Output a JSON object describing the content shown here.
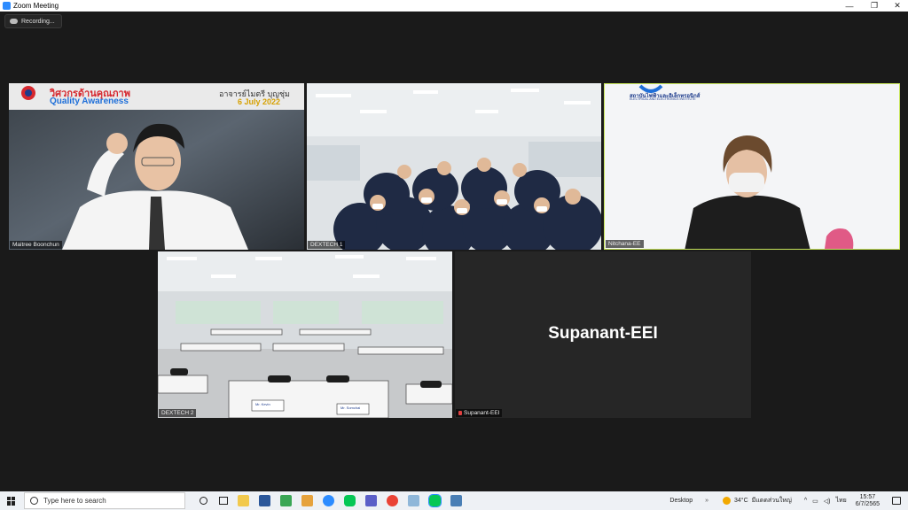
{
  "window": {
    "title": "Zoom Meeting",
    "controls": [
      "—",
      "❐",
      "✕"
    ]
  },
  "recording": {
    "label": "Recording..."
  },
  "tiles": [
    {
      "name": "Maitree Boonchun",
      "slide_title": "วิศวกรด้านคุณภาพ",
      "slide_subtitle": "Quality Awareness",
      "slide_speaker": "อาจารย์ไมตรี บุญชุ่ม",
      "slide_date": "6 July 2022"
    },
    {
      "name": "DEXTECH 1"
    },
    {
      "name": "Nitchana-EE",
      "bg_org_thai": "สถาบันไฟฟ้าและอิเล็กทรอนิกส์",
      "bg_org_en": "ELECTRICAL AND ELECTRONICS INSTITUTE"
    },
    {
      "name": "DEXTECH 2",
      "nameplate_1": "Mr. Kevin",
      "nameplate_2": "Mr. Somchai"
    },
    {
      "name": "Supanant-EEI",
      "display_name": "Supanant-EEI",
      "muted": true
    }
  ],
  "taskbar": {
    "search_placeholder": "Type here to search",
    "desktop_label": "Desktop",
    "weather_temp": "34°C",
    "weather_desc": "มีแดดส่วนใหญ่",
    "lang": "ไทย",
    "time": "15:57",
    "date": "6/7/2565"
  },
  "colors": {
    "accent": "#2d8cff",
    "active_speaker": "#c8e65a",
    "slide_red": "#d6282e"
  }
}
